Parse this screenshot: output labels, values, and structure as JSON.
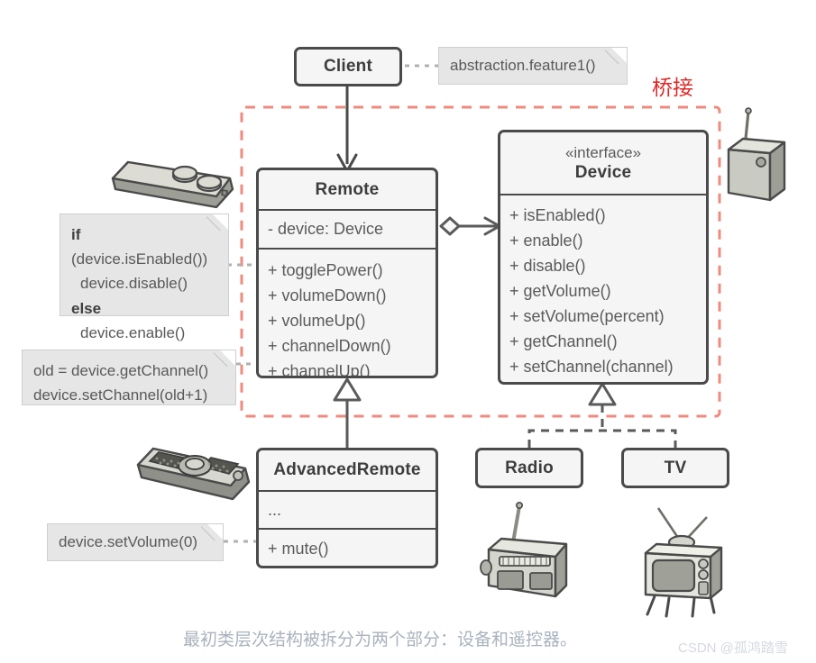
{
  "diagram": {
    "title_label": "桥接",
    "caption": "最初类层次结构被拆分为两个部分：设备和遥控器。",
    "watermark": "CSDN @孤鸿踏雪",
    "accent_color": "#ef8a7e",
    "label_color": "#e02828",
    "box_fill": "#f5f5f5",
    "box_border": "#4a4a4a",
    "note_fill": "#e6e6e6",
    "text_color": "#5a5a5a",
    "caption_color": "#aab2bd"
  },
  "classes": {
    "client": {
      "name": "Client"
    },
    "remote": {
      "name": "Remote",
      "attributes": [
        "- device: Device"
      ],
      "methods": [
        "+ togglePower()",
        "+ volumeDown()",
        "+ volumeUp()",
        "+ channelDown()",
        "+ channelUp()"
      ]
    },
    "device": {
      "stereotype": "«interface»",
      "name": "Device",
      "methods": [
        "+ isEnabled()",
        "+ enable()",
        "+ disable()",
        "+ getVolume()",
        "+ setVolume(percent)",
        "+ getChannel()",
        "+ setChannel(channel)"
      ]
    },
    "advanced_remote": {
      "name": "AdvancedRemote",
      "attributes": [
        "..."
      ],
      "methods": [
        "+ mute()"
      ]
    },
    "radio": {
      "name": "Radio"
    },
    "tv": {
      "name": "TV"
    }
  },
  "notes": {
    "client_note": {
      "text": "abstraction.feature1()"
    },
    "toggle_note": {
      "line1_bold": "if",
      "line1_rest": " (device.isEnabled())",
      "line2": "device.disable()",
      "line3_bold": "else",
      "line4": "device.enable()"
    },
    "channel_note": {
      "line1": "old = device.getChannel()",
      "line2": "device.setChannel(old+1)"
    },
    "mute_note": {
      "text": "device.setVolume(0)"
    }
  },
  "illustrations": {
    "simple_remote": "simple-remote-illustration",
    "advanced_remote": "advanced-remote-illustration",
    "receiver_box": "receiver-box-illustration",
    "radio_set": "radio-set-illustration",
    "tv_set": "tv-set-illustration"
  },
  "connectors": {
    "client_to_remote": "dependency-arrow",
    "remote_to_device": "aggregation-arrow",
    "remote_to_advanced": "inheritance-arrow",
    "device_to_radio_tv": "realization-arrow"
  }
}
